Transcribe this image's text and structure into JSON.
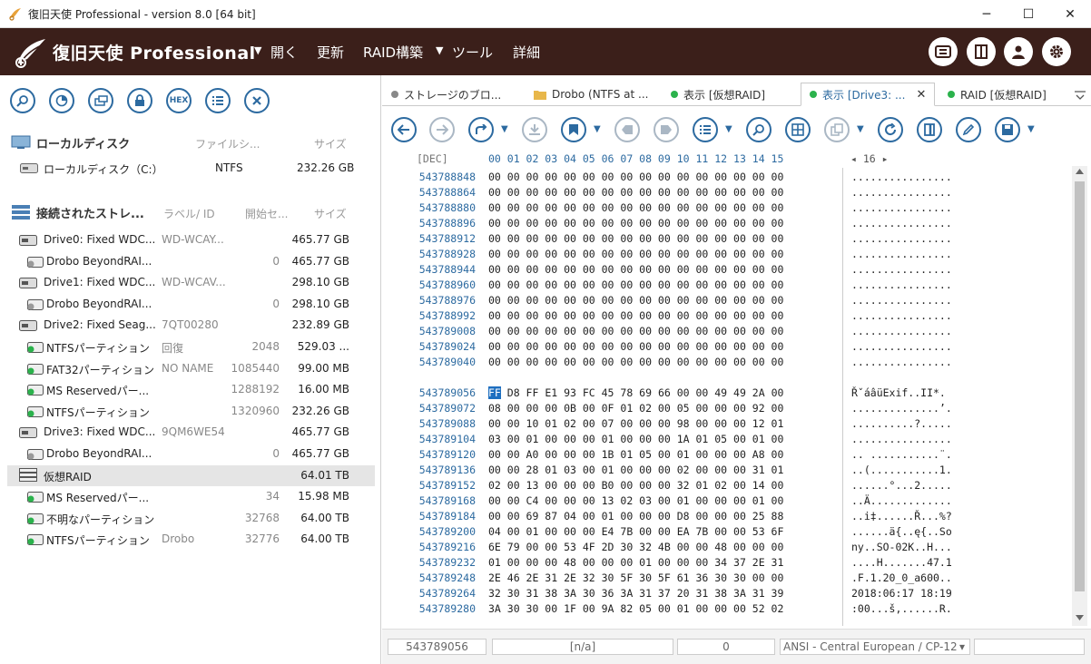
{
  "window": {
    "title": "復旧天使 Professional - version 8.0 [64 bit]",
    "min": "─",
    "max": "☐",
    "close": "✕"
  },
  "menubar": {
    "brand": "復旧天使 Professional",
    "items": [
      "開く",
      "更新",
      "RAID構築",
      "ツール",
      "詳細"
    ],
    "dropdown_glyph": "▼"
  },
  "left_toolbar": {
    "hex_label": "HEX"
  },
  "local_section": {
    "title": "ローカルディスク",
    "col_fs": "ファイルシ...",
    "col_size": "サイズ",
    "rows": [
      {
        "name": "ローカルディスク（C:）",
        "fs": "NTFS",
        "size": "232.26 GB"
      }
    ]
  },
  "storage_section": {
    "title": "接続されたストレ...",
    "col_label": "ラベル/ ID",
    "col_start": "開始セ...",
    "col_size": "サイズ",
    "rows": [
      {
        "name": "Drive0: Fixed WDC...",
        "label": "WD-WCAY...",
        "start": "",
        "size": "465.77 GB",
        "kind": "drive",
        "indent": 0
      },
      {
        "name": "Drobo BeyondRAI...",
        "label": "",
        "start": "0",
        "size": "465.77 GB",
        "kind": "part-gray",
        "indent": 1
      },
      {
        "name": "Drive1: Fixed WDC...",
        "label": "WD-WCAV...",
        "start": "",
        "size": "298.10 GB",
        "kind": "drive",
        "indent": 0
      },
      {
        "name": "Drobo BeyondRAI...",
        "label": "",
        "start": "0",
        "size": "298.10 GB",
        "kind": "part-gray",
        "indent": 1
      },
      {
        "name": "Drive2: Fixed Seag...",
        "label": "7QT00280",
        "start": "",
        "size": "232.89 GB",
        "kind": "drive",
        "indent": 0
      },
      {
        "name": "NTFSパーティション",
        "label": "回復",
        "start": "2048",
        "size": "529.03 ...",
        "kind": "part-green",
        "indent": 1
      },
      {
        "name": "FAT32パーティション",
        "label": "NO NAME",
        "start": "1085440",
        "size": "99.00 MB",
        "kind": "part-green",
        "indent": 1
      },
      {
        "name": "MS Reservedパー...",
        "label": "",
        "start": "1288192",
        "size": "16.00 MB",
        "kind": "part-green",
        "indent": 1
      },
      {
        "name": "NTFSパーティション",
        "label": "",
        "start": "1320960",
        "size": "232.26 GB",
        "kind": "part-green",
        "indent": 1
      },
      {
        "name": "Drive3: Fixed WDC...",
        "label": "9QM6WE54",
        "start": "",
        "size": "465.77 GB",
        "kind": "drive",
        "indent": 0
      },
      {
        "name": "Drobo BeyondRAI...",
        "label": "",
        "start": "0",
        "size": "465.77 GB",
        "kind": "part-gray",
        "indent": 1
      },
      {
        "name": "仮想RAID",
        "label": "",
        "start": "",
        "size": "64.01 TB",
        "kind": "raid",
        "indent": 0,
        "selected": true
      },
      {
        "name": "MS Reservedパー...",
        "label": "",
        "start": "34",
        "size": "15.98 MB",
        "kind": "part-green",
        "indent": 1
      },
      {
        "name": "不明なパーティション",
        "label": "",
        "start": "32768",
        "size": "64.00 TB",
        "kind": "part-green",
        "indent": 1
      },
      {
        "name": "NTFSパーティション",
        "label": "Drobo",
        "start": "32776",
        "size": "64.00 TB",
        "kind": "part-green",
        "indent": 1
      }
    ]
  },
  "tabs": [
    {
      "label": "ストレージのブロ...",
      "dot": "#888888",
      "active": false
    },
    {
      "label": "Drobo (NTFS at ...",
      "dot": "folder",
      "active": false
    },
    {
      "label": "表示 [仮想RAID]",
      "dot": "#2bb24c",
      "active": false
    },
    {
      "label": "表示 [Drive3: ...",
      "dot": "#2bb24c",
      "active": true,
      "close": "✕"
    },
    {
      "label": "RAID [仮想RAID]",
      "dot": "#2bb24c",
      "active": false
    }
  ],
  "hex": {
    "base_label": "[DEC]",
    "columns": "00 01 02 03 04 05 06 07 08 09 10 11 12 13 14 15",
    "width_ctl": "◂  16  ▸",
    "rows": [
      {
        "off": "543788848",
        "bytes": "00 00 00 00 00 00 00 00 00 00 00 00 00 00 00 00",
        "ascii": "................"
      },
      {
        "off": "543788864",
        "bytes": "00 00 00 00 00 00 00 00 00 00 00 00 00 00 00 00",
        "ascii": "................"
      },
      {
        "off": "543788880",
        "bytes": "00 00 00 00 00 00 00 00 00 00 00 00 00 00 00 00",
        "ascii": "................"
      },
      {
        "off": "543788896",
        "bytes": "00 00 00 00 00 00 00 00 00 00 00 00 00 00 00 00",
        "ascii": "................"
      },
      {
        "off": "543788912",
        "bytes": "00 00 00 00 00 00 00 00 00 00 00 00 00 00 00 00",
        "ascii": "................"
      },
      {
        "off": "543788928",
        "bytes": "00 00 00 00 00 00 00 00 00 00 00 00 00 00 00 00",
        "ascii": "................"
      },
      {
        "off": "543788944",
        "bytes": "00 00 00 00 00 00 00 00 00 00 00 00 00 00 00 00",
        "ascii": "................"
      },
      {
        "off": "543788960",
        "bytes": "00 00 00 00 00 00 00 00 00 00 00 00 00 00 00 00",
        "ascii": "................"
      },
      {
        "off": "543788976",
        "bytes": "00 00 00 00 00 00 00 00 00 00 00 00 00 00 00 00",
        "ascii": "................"
      },
      {
        "off": "543788992",
        "bytes": "00 00 00 00 00 00 00 00 00 00 00 00 00 00 00 00",
        "ascii": "................"
      },
      {
        "off": "543789008",
        "bytes": "00 00 00 00 00 00 00 00 00 00 00 00 00 00 00 00",
        "ascii": "................"
      },
      {
        "off": "543789024",
        "bytes": "00 00 00 00 00 00 00 00 00 00 00 00 00 00 00 00",
        "ascii": "................"
      },
      {
        "off": "543789040",
        "bytes": "00 00 00 00 00 00 00 00 00 00 00 00 00 00 00 00",
        "ascii": "................"
      },
      {
        "off": "",
        "bytes": "",
        "ascii": ""
      },
      {
        "off": "543789056",
        "bytes": "   D8 FF E1 93 FC 45 78 69 66 00 00 49 49 2A 00",
        "ascii": "ŘˇáâüExif..II*.",
        "sel": "FF"
      },
      {
        "off": "543789072",
        "bytes": "08 00 00 00 0B 00 0F 01 02 00 05 00 00 00 92 00",
        "ascii": "..............’."
      },
      {
        "off": "543789088",
        "bytes": "00 00 10 01 02 00 07 00 00 00 98 00 00 00 12 01",
        "ascii": "..........?....."
      },
      {
        "off": "543789104",
        "bytes": "03 00 01 00 00 00 01 00 00 00 1A 01 05 00 01 00",
        "ascii": "................"
      },
      {
        "off": "543789120",
        "bytes": "00 00 A0 00 00 00 1B 01 05 00 01 00 00 00 A8 00",
        "ascii": ".. ...........¨."
      },
      {
        "off": "543789136",
        "bytes": "00 00 28 01 03 00 01 00 00 00 02 00 00 00 31 01",
        "ascii": "..(...........1."
      },
      {
        "off": "543789152",
        "bytes": "02 00 13 00 00 00 B0 00 00 00 32 01 02 00 14 00",
        "ascii": "......°...2....."
      },
      {
        "off": "543789168",
        "bytes": "00 00 C4 00 00 00 13 02 03 00 01 00 00 00 01 00",
        "ascii": "..Ä............."
      },
      {
        "off": "543789184",
        "bytes": "00 00 69 87 04 00 01 00 00 00 D8 00 00 00 25 88",
        "ascii": "..i‡......Ř...%?"
      },
      {
        "off": "543789200",
        "bytes": "04 00 01 00 00 00 E4 7B 00 00 EA 7B 00 00 53 6F",
        "ascii": "......ä{..ę{..So"
      },
      {
        "off": "543789216",
        "bytes": "6E 79 00 00 53 4F 2D 30 32 4B 00 00 48 00 00 00",
        "ascii": "ny..SO-02K..H..."
      },
      {
        "off": "543789232",
        "bytes": "01 00 00 00 48 00 00 00 01 00 00 00 34 37 2E 31",
        "ascii": "....H.......47.1"
      },
      {
        "off": "543789248",
        "bytes": "2E 46 2E 31 2E 32 30 5F 30 5F 61 36 30 30 00 00",
        "ascii": ".F.1.20_0_a600.."
      },
      {
        "off": "543789264",
        "bytes": "32 30 31 38 3A 30 36 3A 31 37 20 31 38 3A 31 39",
        "ascii": "2018:06:17 18:19"
      },
      {
        "off": "543789280",
        "bytes": "3A 30 30 00 1F 00 9A 82 05 00 01 00 00 00 52 02",
        "ascii": ":00...š‚......R."
      }
    ]
  },
  "statusbar": {
    "offset": "543789056",
    "value": "[n/a]",
    "zero": "0",
    "encoding": "ANSI - Central European / CP-12",
    "enc_arrow": "▾"
  }
}
